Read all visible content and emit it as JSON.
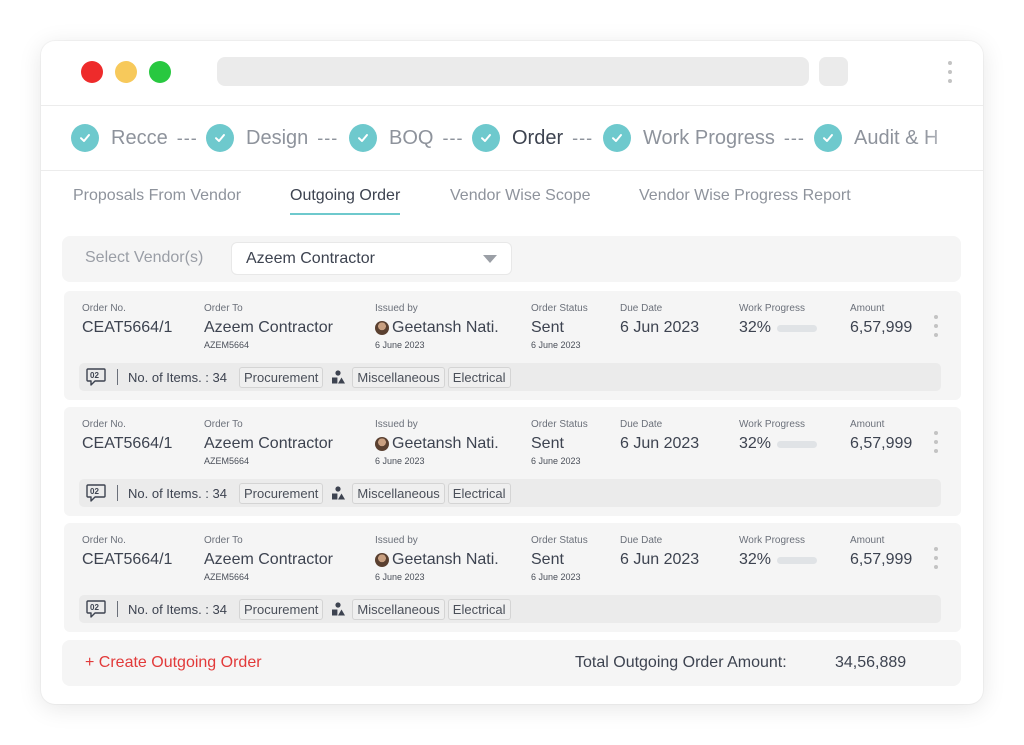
{
  "window": {
    "colors": {
      "close": "#ee2b2b",
      "minimize": "#f7c95b",
      "maximize": "#28c840",
      "accent": "#6ec9cd",
      "danger": "#e23a3a"
    }
  },
  "stepper": {
    "steps": [
      {
        "label": "Recce",
        "sep": "---",
        "state": "done"
      },
      {
        "label": "Design",
        "sep": "---",
        "state": "done"
      },
      {
        "label": "BOQ",
        "sep": "---",
        "state": "done"
      },
      {
        "label": "Order",
        "sep": "---",
        "state": "active"
      },
      {
        "label": "Work Progress",
        "sep": "---",
        "state": "done"
      },
      {
        "label": "Audit & H",
        "sep": "",
        "state": "done"
      }
    ]
  },
  "subtabs": [
    {
      "label": "Proposals From Vendor"
    },
    {
      "label": "Outgoing Order",
      "active": true
    },
    {
      "label": "Vendor Wise Scope"
    },
    {
      "label": "Vendor Wise Progress Report"
    }
  ],
  "vendor_filter": {
    "label": "Select Vendor(s)",
    "selected": "Azeem Contractor",
    "icon": "chevron-down-icon"
  },
  "columns": {
    "order_no": "Order No.",
    "order_to": "Order To",
    "issued_by": "Issued by",
    "order_status": "Order Status",
    "due_date": "Due Date",
    "work_progress": "Work Progress",
    "amount": "Amount"
  },
  "orders": [
    {
      "order_no": "CEAT5664/1",
      "order_to": "Azeem Contractor",
      "order_to_code": "AZEM5664",
      "issued_by": "Geetansh Nati.",
      "issued_date": "6 June 2023",
      "status": "Sent",
      "status_date": "6 June 2023",
      "due_date": "6 Jun 2023",
      "progress_label": "32%",
      "progress": 0.32,
      "amount": "6,57,999",
      "comments": "02",
      "items": "No. of Items. : 34",
      "tags": [
        "Procurement",
        "Miscellaneous",
        "Electrical"
      ]
    },
    {
      "order_no": "CEAT5664/1",
      "order_to": "Azeem Contractor",
      "order_to_code": "AZEM5664",
      "issued_by": "Geetansh Nati.",
      "issued_date": "6 June 2023",
      "status": "Sent",
      "status_date": "6 June 2023",
      "due_date": "6 Jun 2023",
      "progress_label": "32%",
      "progress": 0.32,
      "amount": "6,57,999",
      "comments": "02",
      "items": "No. of Items. : 34",
      "tags": [
        "Procurement",
        "Miscellaneous",
        "Electrical"
      ]
    },
    {
      "order_no": "CEAT5664/1",
      "order_to": "Azeem Contractor",
      "order_to_code": "AZEM5664",
      "issued_by": "Geetansh Nati.",
      "issued_date": "6 June 2023",
      "status": "Sent",
      "status_date": "6 June 2023",
      "due_date": "6 Jun 2023",
      "progress_label": "32%",
      "progress": 0.32,
      "amount": "6,57,999",
      "comments": "02",
      "items": "No. of Items. : 34",
      "tags": [
        "Procurement",
        "Miscellaneous",
        "Electrical"
      ]
    }
  ],
  "footer": {
    "create_label": "+ Create Outgoing Order",
    "total_label": "Total Outgoing Order Amount:",
    "total_value": "34,56,889"
  }
}
